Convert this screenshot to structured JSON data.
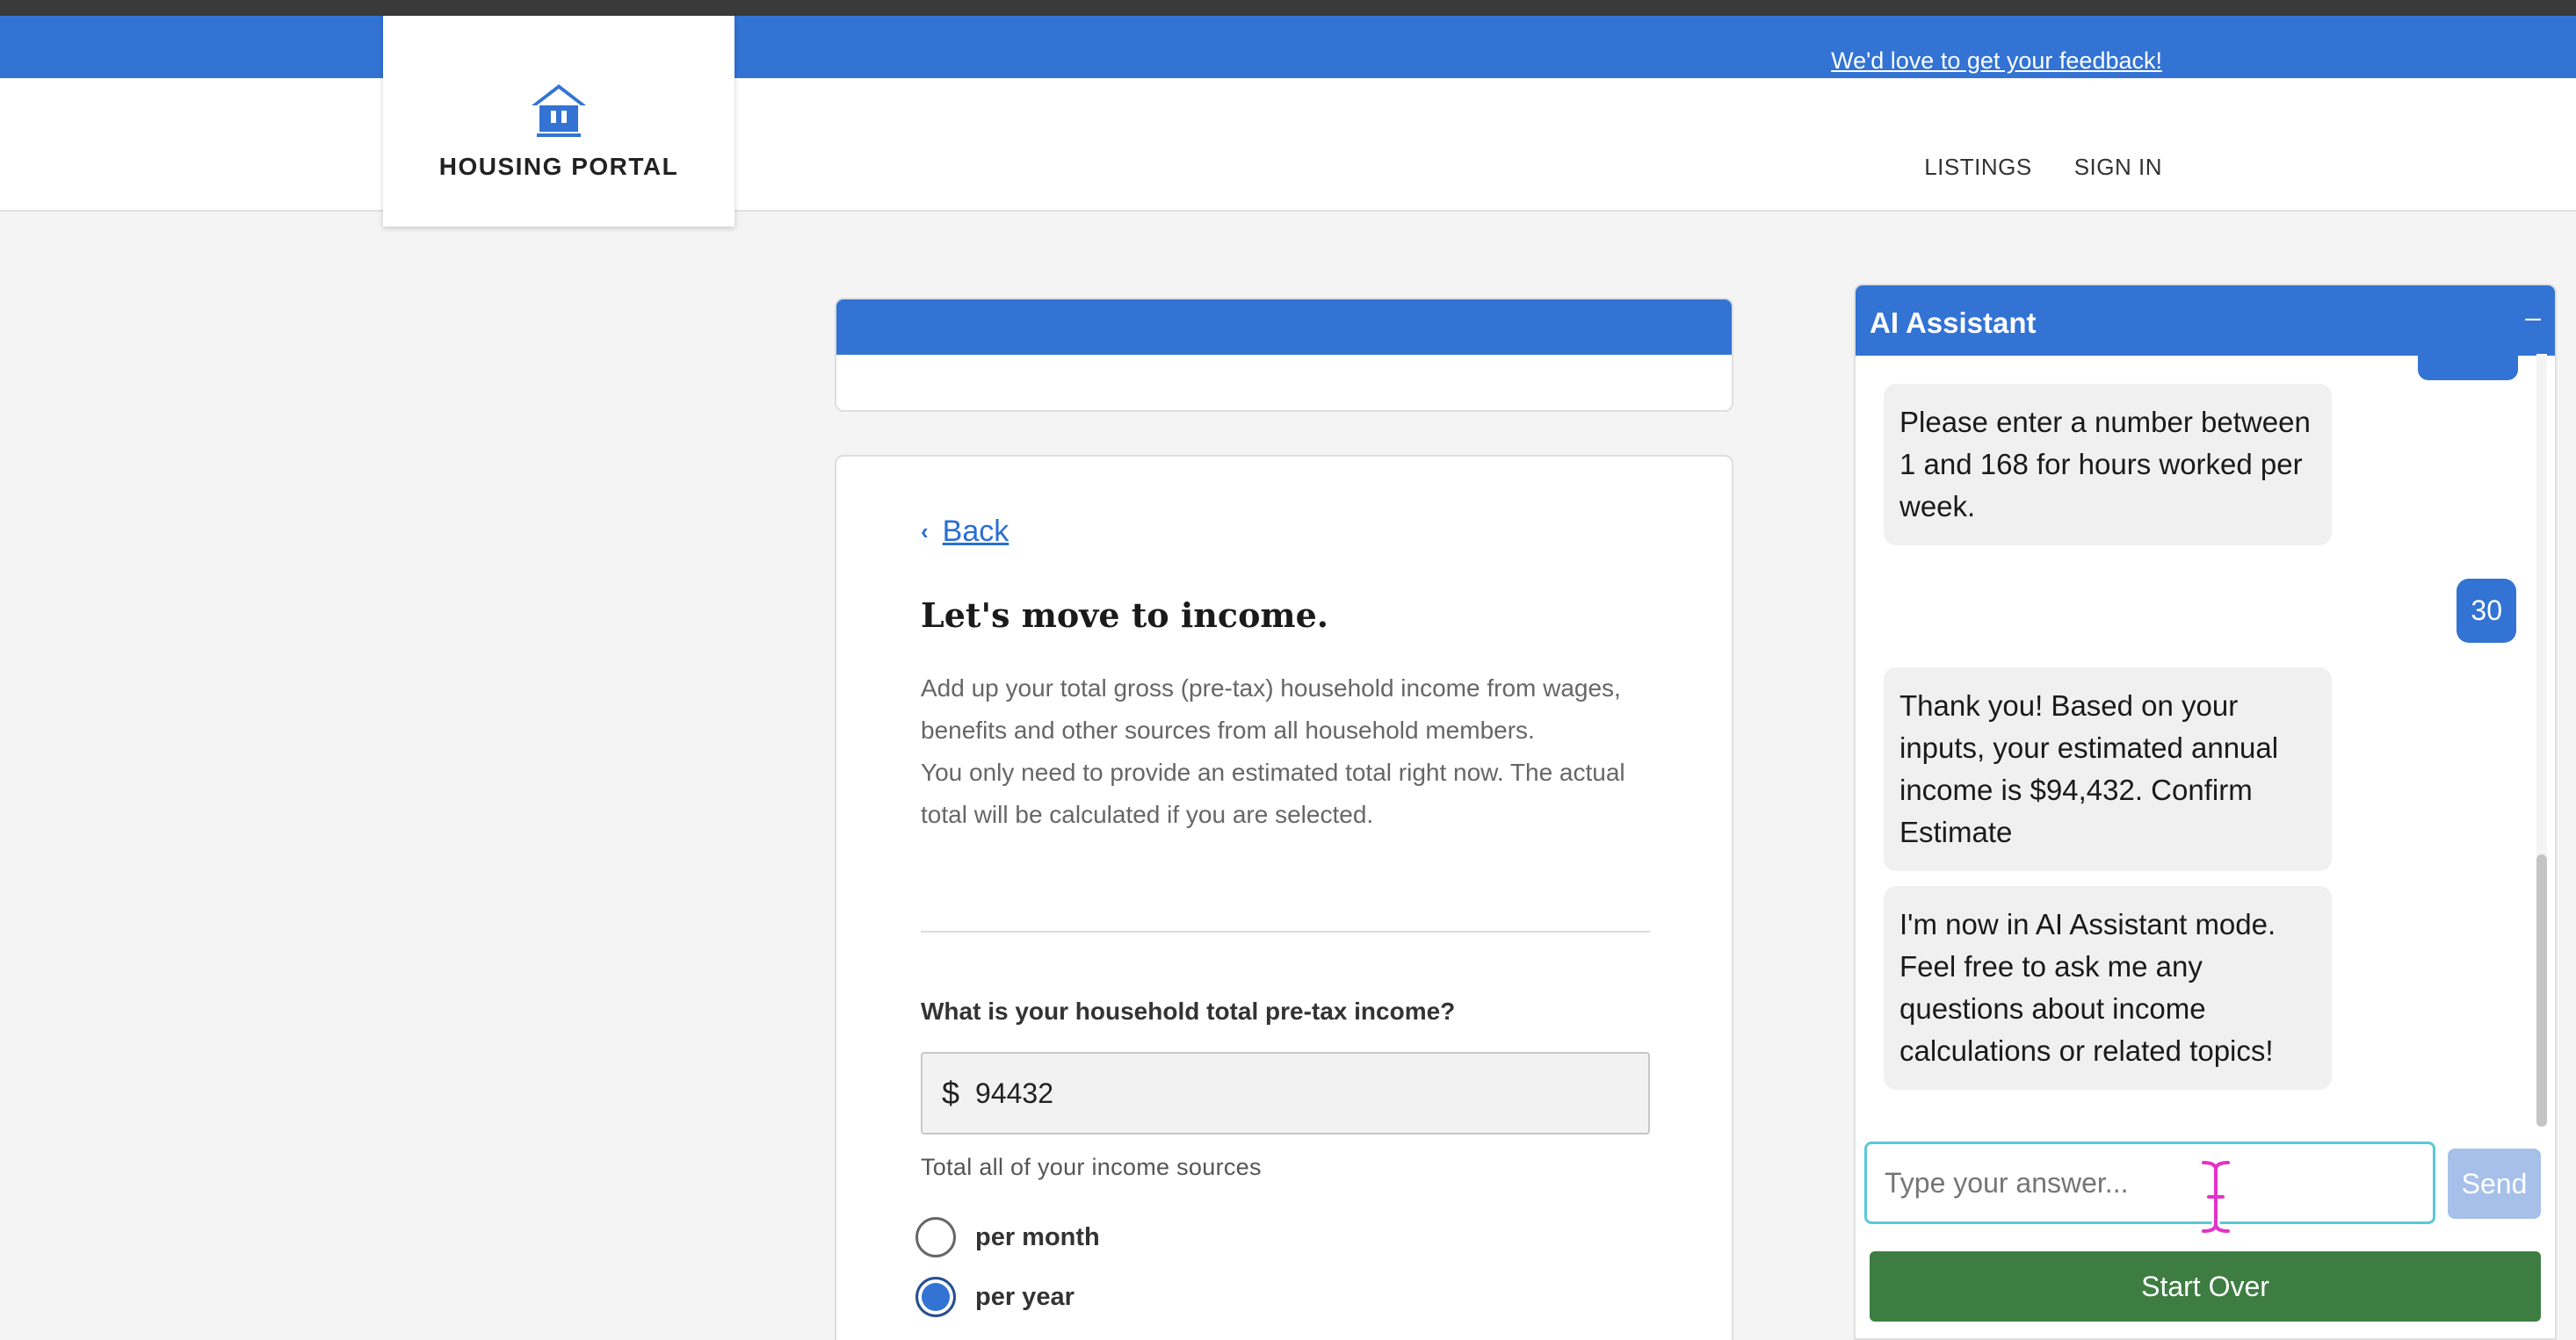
{
  "header": {
    "feedback_link": "We'd love to get your feedback!",
    "logo_text": "HOUSING PORTAL",
    "nav": [
      "LISTINGS",
      "SIGN IN"
    ]
  },
  "form": {
    "back_label": "Back",
    "heading": "Let's move to income.",
    "description_1": "Add up your total gross (pre-tax) household income from wages, benefits and other sources from all household members.",
    "description_2": "You only need to provide an estimated total right now. The actual total will be calculated if you are selected.",
    "question": "What is your household total pre-tax income?",
    "currency_symbol": "$",
    "income_value": "94432",
    "help_text": "Total all of your income sources",
    "radio_options": [
      "per month",
      "per year"
    ],
    "selected_option": "per year"
  },
  "chat": {
    "title": "AI Assistant",
    "minimize_icon": "–",
    "messages": [
      {
        "from": "assistant",
        "text": "Please enter a number between 1 and 168 for hours worked per week."
      },
      {
        "from": "user",
        "text": "30"
      },
      {
        "from": "assistant",
        "text": "Thank you! Based on your inputs, your estimated annual income is $94,432. Confirm Estimate"
      },
      {
        "from": "assistant",
        "text": "I'm now in AI Assistant mode. Feel free to ask me any questions about income calculations or related topics!"
      }
    ],
    "input_placeholder": "Type your answer...",
    "send_label": "Send",
    "start_over_label": "Start Over"
  },
  "colors": {
    "brand_blue": "#3273d4",
    "start_over_green": "#3e7d42",
    "input_focus": "#5ac8d8"
  }
}
